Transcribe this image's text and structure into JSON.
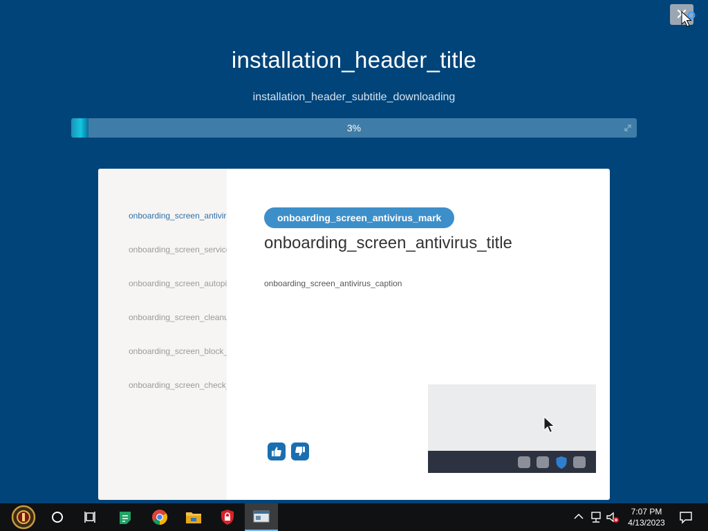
{
  "installer": {
    "close_glyph": "✕",
    "header_title": "installation_header_title",
    "header_subtitle": "installation_header_subtitle_downloading",
    "progress": {
      "percent": 3,
      "label": "3%"
    }
  },
  "onboarding": {
    "sidebar_items": [
      "onboarding_screen_antivirus_title",
      "onboarding_screen_services_title",
      "onboarding_screen_autopilot_title",
      "onboarding_screen_cleanup_title",
      "onboarding_screen_block_title",
      "onboarding_screen_check_title"
    ],
    "active_index": 0,
    "mark": "onboarding_screen_antivirus_mark",
    "title": "onboarding_screen_antivirus_title",
    "caption": "onboarding_screen_antivirus_caption"
  },
  "icons": {
    "close": "close-icon",
    "thumbs_up": "thumbs-up-icon",
    "thumbs_down": "thumbs-down-icon",
    "cursor": "cursor-icon",
    "shield": "shield-icon"
  },
  "taskbar": {
    "apps": [
      "start-icon",
      "cortana-icon",
      "task-view-icon",
      "notes-app-icon",
      "chrome-icon",
      "file-explorer-icon",
      "security-app-icon",
      "installer-app-icon"
    ],
    "time": "7:07 PM",
    "date": "4/13/2023"
  },
  "colors": {
    "background": "#00447a",
    "progress_track": "#3f7da8",
    "progress_fill": "#13c6e0",
    "accent": "#3d8fc9",
    "feedback_button": "#1b6fb0",
    "taskbar": "#101113"
  }
}
